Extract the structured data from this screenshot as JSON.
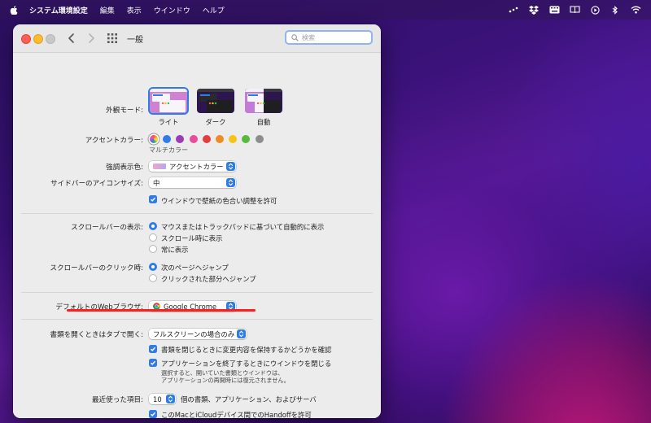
{
  "menubar": {
    "app_name": "システム環境設定",
    "items": [
      "編集",
      "表示",
      "ウインドウ",
      "ヘルプ"
    ]
  },
  "window": {
    "title": "一般",
    "search_placeholder": "検索"
  },
  "appearance": {
    "label": "外観モード:",
    "options": [
      "ライト",
      "ダーク",
      "自動"
    ],
    "selected": "ライト"
  },
  "accent": {
    "label": "アクセントカラー:",
    "colors": [
      "#a970ff",
      "#2f7ce8",
      "#9b3bb5",
      "#ea4b9a",
      "#e33d3d",
      "#f08a24",
      "#f5c417",
      "#58b93b",
      "#8d8d8d"
    ],
    "selected_caption": "マルチカラー"
  },
  "highlight": {
    "label": "強調表示色:",
    "value": "アクセントカラー"
  },
  "sidebar_icon": {
    "label": "サイドバーのアイコンサイズ:",
    "value": "中"
  },
  "wallpaper_tint": {
    "label": "ウインドウで壁紙の色合い調整を許可",
    "checked": true
  },
  "scrollbars": {
    "label": "スクロールバーの表示:",
    "options": [
      "マウスまたはトラックパッドに基づいて自動的に表示",
      "スクロール時に表示",
      "常に表示"
    ],
    "selected_index": 0
  },
  "scroll_click": {
    "label": "スクロールバーのクリック時:",
    "options": [
      "次のページへジャンプ",
      "クリックされた部分へジャンプ"
    ],
    "selected_index": 0
  },
  "browser": {
    "label": "デフォルトのWebブラウザ:",
    "value": "Google Chrome"
  },
  "tabs": {
    "label": "書類を開くときはタブで開く:",
    "value": "フルスクリーンの場合のみ"
  },
  "ask_keep_changes": {
    "label": "書類を閉じるときに変更内容を保持するかどうかを確認",
    "checked": true
  },
  "close_windows": {
    "label": "アプリケーションを終了するときにウインドウを閉じる",
    "checked": true,
    "note_line1": "選択すると、開いていた書類とウインドウは、",
    "note_line2": "アプリケーションの再開時には復元されません。"
  },
  "recent": {
    "label": "最近使った項目:",
    "value": "10",
    "suffix": "個の書類、アプリケーション、およびサーバ"
  },
  "handoff": {
    "label": "このMacとiCloudデバイス間でのHandoffを許可",
    "checked": true
  },
  "help_label": "?"
}
